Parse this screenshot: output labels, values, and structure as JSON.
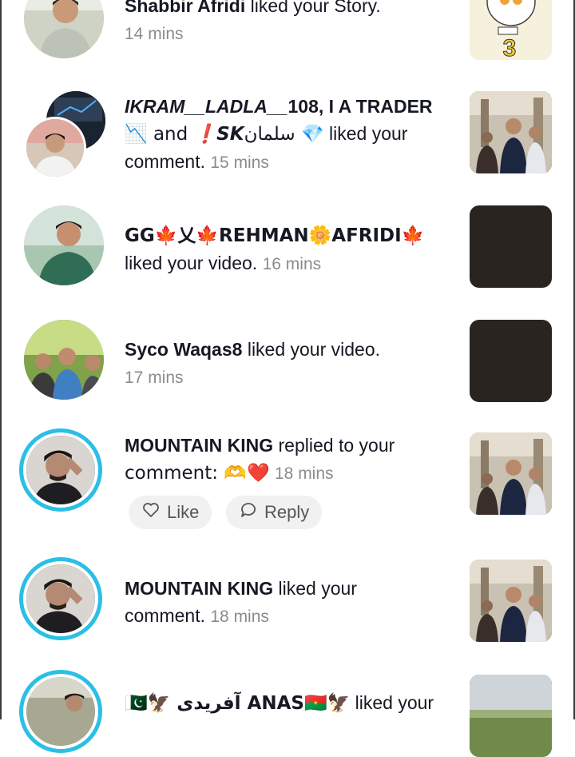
{
  "notifications": [
    {
      "name": "Shabbir Afridi",
      "action": " liked your Story.",
      "time": "14 mins"
    },
    {
      "name": "IKRAM__LADLA__",
      "name_suffix": "108, I A TRADER",
      "line2_prefix": "📉 and ",
      "second_name": "❗SK",
      "second_name_tail": "سلمان 💎",
      "action": " liked your",
      "action_line3": "comment.",
      "time": "15 mins"
    },
    {
      "name": "GG🍁乂🍁REHMAN🌼AFRIDI🍁",
      "action": "liked your video.",
      "time": "16 mins"
    },
    {
      "name": "Syco Waqas8",
      "action": " liked your video.",
      "time": "17 mins"
    },
    {
      "name": "MOUNTAIN KING",
      "action": " replied to your",
      "action_line2": "comment: 🫶❤️",
      "time": "18 mins",
      "like_label": "Like",
      "reply_label": "Reply"
    },
    {
      "name": "MOUNTAIN KING",
      "action": " liked your",
      "action_line2": "comment.",
      "time": "18 mins"
    },
    {
      "name": "🇵🇰🦅 آفریدی ANAS🇧🇫🦅",
      "action": " liked your"
    }
  ],
  "colors": {
    "story_ring": "#2bbfe6",
    "time": "#8a8b91",
    "button_bg": "#f1f1f2"
  }
}
